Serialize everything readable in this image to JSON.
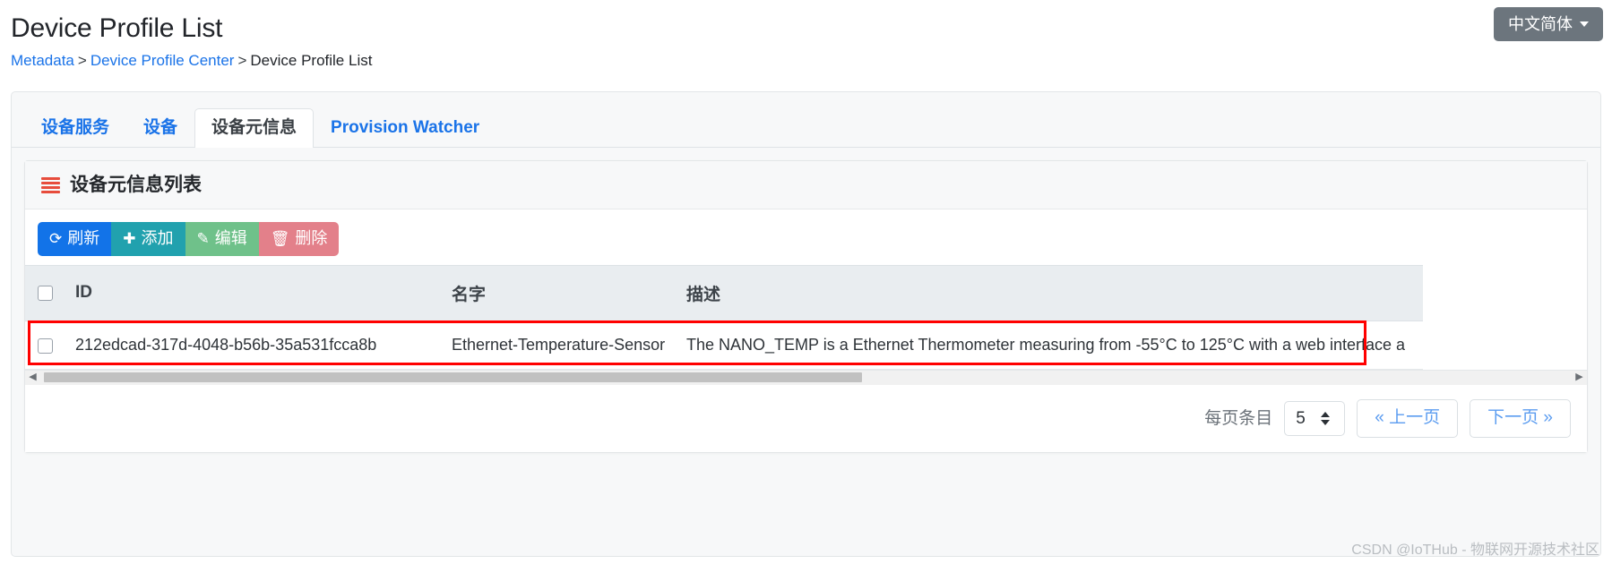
{
  "header": {
    "title": "Device Profile List",
    "breadcrumb": {
      "root": "Metadata",
      "sep1": ">",
      "middle": "Device Profile Center",
      "sep2": ">",
      "current": "Device Profile List"
    },
    "language_button": {
      "label": "中文简体",
      "icon": "caret-down-icon"
    }
  },
  "tabs": [
    {
      "label": "设备服务",
      "active": false
    },
    {
      "label": "设备",
      "active": false
    },
    {
      "label": "设备元信息",
      "active": true
    },
    {
      "label": "Provision Watcher",
      "active": false
    }
  ],
  "card": {
    "icon": "list-icon",
    "title": "设备元信息列表",
    "toolbar": [
      {
        "label": "刷新",
        "icon": "refresh-icon",
        "glyph": "⟳",
        "color": "#1273e8"
      },
      {
        "label": "添加",
        "icon": "plus-icon",
        "glyph": "✚",
        "color": "#21a1ae"
      },
      {
        "label": "编辑",
        "icon": "edit-icon",
        "glyph": "✎",
        "color": "#6fc18a"
      },
      {
        "label": "删除",
        "icon": "trash-icon",
        "glyph": "🗑",
        "color": "#e3808a"
      }
    ]
  },
  "table": {
    "columns": [
      "",
      "ID",
      "名字",
      "描述"
    ],
    "rows": [
      {
        "id": "212edcad-317d-4048-b56b-35a531fcca8b",
        "name": "Ethernet-Temperature-Sensor",
        "description": "The NANO_TEMP is a Ethernet Thermometer measuring from -55°C to 125°C with a web interface a"
      }
    ],
    "highlight_color": "#ff0000"
  },
  "pagination": {
    "per_page_label": "每页条目",
    "per_page_value": "5",
    "prev_label": "« 上一页",
    "next_label": "下一页 »"
  },
  "watermark": "CSDN @IoTHub - 物联网开源技术社区"
}
